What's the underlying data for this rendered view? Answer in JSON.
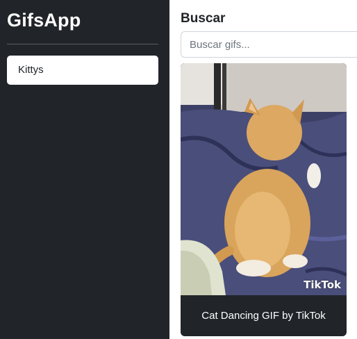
{
  "sidebar": {
    "title": "GifsApp",
    "history": [
      {
        "label": "Kittys"
      }
    ]
  },
  "search": {
    "heading": "Buscar",
    "placeholder": "Buscar gifs...",
    "value": ""
  },
  "results": [
    {
      "title": "Cat Dancing GIF by TikTok",
      "watermark": "TikTok"
    }
  ],
  "colors": {
    "sidebar_bg": "#212529",
    "card_bg": "#212529",
    "accent_text": "#ffffff"
  }
}
